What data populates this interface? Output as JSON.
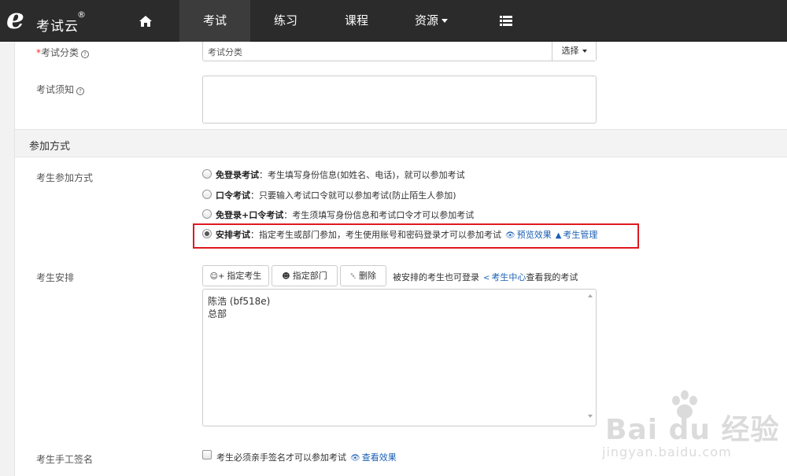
{
  "navbar": {
    "logo_letter": "e",
    "logo_text": "考试云",
    "logo_reg": "®",
    "items": [
      {
        "label": "考试",
        "active": true
      },
      {
        "label": "练习",
        "active": false
      },
      {
        "label": "课程",
        "active": false
      },
      {
        "label": "资源",
        "active": false
      }
    ],
    "home_icon": "home-icon",
    "menu_icon": "list-menu-icon"
  },
  "form": {
    "category": {
      "required_mark": "*",
      "label": "考试分类",
      "value": "考试分类",
      "select_label": "选择"
    },
    "notice": {
      "label": "考试须知",
      "value": ""
    },
    "section_title": "参加方式",
    "join_mode": {
      "label": "考生参加方式",
      "options": [
        {
          "title": "免登录考试",
          "desc": "：考生填写身份信息(如姓名、电话)，就可以参加考试",
          "checked": false
        },
        {
          "title": "口令考试",
          "desc": "：只要输入考试口令就可以参加考试(防止陌生人参加)",
          "checked": false
        },
        {
          "title": "免登录+口令考试",
          "desc": "：考生须填写身份信息和考试口令才可以参加考试",
          "checked": false
        },
        {
          "title": "安排考试",
          "desc": "：指定考生或部门参加，考生使用账号和密码登录才可以参加考试",
          "checked": true
        }
      ],
      "preview_link": "预览效果",
      "manage_link": "考生管理"
    },
    "arrange": {
      "label": "考生安排",
      "btn_assign_user": "指定考生",
      "btn_assign_dept": "指定部门",
      "btn_delete": "删除",
      "hint_prefix": "被安排的考生也可登录",
      "hint_link": "考生中心",
      "hint_suffix": "查看我的考试",
      "entries": [
        "陈浩 (bf518e)",
        "总部"
      ]
    },
    "signature": {
      "label": "考生手工签名",
      "checkbox_text": "考生必须亲手签名才可以参加考试",
      "checked": false,
      "link": "查看效果"
    }
  },
  "watermark": {
    "main": "Bai du 经验",
    "sub": "jingyan.baidu.com"
  }
}
